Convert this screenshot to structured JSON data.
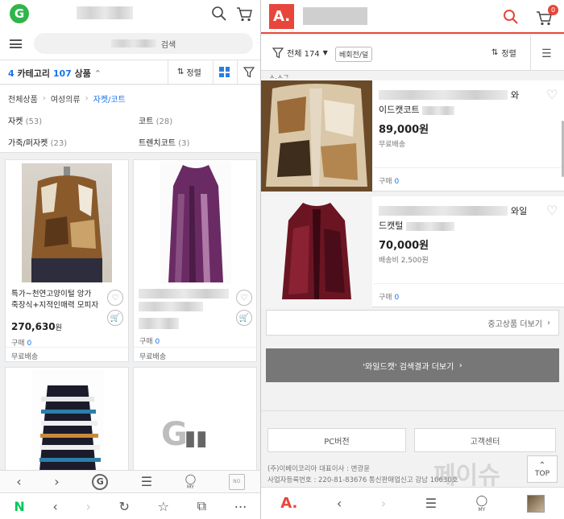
{
  "left": {
    "search_placeholder": "검색",
    "filter": {
      "cat_count": "4",
      "cat_label": "카테고리",
      "prod_count": "107",
      "prod_label": "상품",
      "sort_label": "정렬"
    },
    "breadcrumb": [
      "전체상품",
      "여성의류",
      "자켓/코트"
    ],
    "categories": [
      {
        "name": "자켓",
        "count": "(53)"
      },
      {
        "name": "코트",
        "count": "(28)"
      },
      {
        "name": "가죽/퍼자켓",
        "count": "(23)"
      },
      {
        "name": "트렌치코트",
        "count": "(3)"
      }
    ],
    "products": [
      {
        "title_line1": "특가~천연고양이털 앙가",
        "title_line2": "죽장식+지적인매력 모피자",
        "price": "270,630",
        "won": "원",
        "buy_label": "구매",
        "buy_count": "0",
        "shipping": "무료배송"
      },
      {
        "title_line1": "",
        "title_line2": "",
        "price": "",
        "won": "",
        "buy_label": "구매",
        "buy_count": "0",
        "shipping": "무료배송"
      }
    ],
    "placeholder_logo": "G",
    "nav_no": "NO",
    "nav_my": "MY",
    "browser_logo": "N"
  },
  "right": {
    "logo": "A.",
    "cart_badge": "0",
    "filter": {
      "all_label": "전체 174",
      "tag": "베회전/덜",
      "sort_label": "정렬"
    },
    "partial_text": "ㅅ.ㅅㄱ",
    "products": [
      {
        "title_tail": "와",
        "title_line2": "이드캣코트",
        "price": "89,000원",
        "shipping": "무료배송",
        "buy_label": "구매",
        "buy_count": "0"
      },
      {
        "title_tail": "와일",
        "title_line2": "드캣털",
        "price": "70,000원",
        "shipping": "배송비 2,500원",
        "buy_label": "구매",
        "buy_count": "0"
      }
    ],
    "more_products": "중고상품 더보기",
    "more_search": "'와일드캣' 검색결과 더보기",
    "pc_version": "PC버전",
    "customer_center": "고객센터",
    "footer_line1": "(주)이베이코리아   대표이사 : 변광윤",
    "footer_line2": "사업자등록번호 : 220-81-83676   통신판매업신고 강남 10630호",
    "top_label": "TOP",
    "my_label": "MY",
    "watermark": "페이슈"
  },
  "colors": {
    "gmarket_green": "#2fb64a",
    "auction_red": "#e8463c",
    "link_blue": "#1a73e8",
    "naver_green": "#03c75a"
  }
}
